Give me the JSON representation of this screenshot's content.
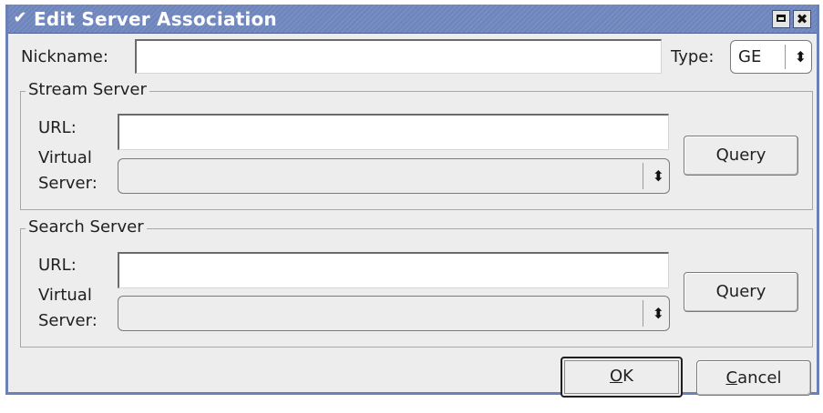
{
  "window": {
    "title": "Edit Server Association",
    "menu_icon": "chevron-down-icon",
    "maximize_icon": "maximize-icon",
    "close_icon": "close-icon"
  },
  "nickname": {
    "label": "Nickname:",
    "value": ""
  },
  "type": {
    "label": "Type:",
    "selected": "GE"
  },
  "stream_server": {
    "title": "Stream Server",
    "url_label": "URL:",
    "url_value": "",
    "virtual_label_1": "Virtual",
    "virtual_label_2": "Server:",
    "virtual_value": "",
    "query_label": "Query"
  },
  "search_server": {
    "title": "Search Server",
    "url_label": "URL:",
    "url_value": "",
    "virtual_label_1": "Virtual",
    "virtual_label_2": "Server:",
    "virtual_value": "",
    "query_label": "Query"
  },
  "buttons": {
    "ok_mnemonic": "O",
    "ok_rest": "K",
    "cancel_mnemonic": "C",
    "cancel_rest": "ancel"
  },
  "colors": {
    "titlebar": "#6f86bd",
    "window_bg": "#ededed"
  }
}
